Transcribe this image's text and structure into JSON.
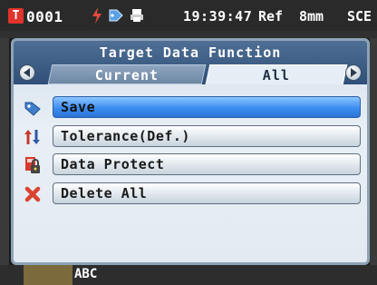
{
  "status_bar": {
    "target_badge": "T",
    "code": "0001",
    "time": "19:39:47",
    "ref": "Ref",
    "aperture": "8mm",
    "mode": "SCE",
    "icons": [
      "lightning-icon",
      "tag-icon",
      "printer-icon"
    ]
  },
  "dialog": {
    "title": "Target Data Function",
    "tabs": [
      {
        "label": "Current",
        "active": false
      },
      {
        "label": "All",
        "active": true
      }
    ],
    "items": [
      {
        "label": "Save",
        "icon": "save-tag-icon",
        "selected": true
      },
      {
        "label": "Tolerance(Def.)",
        "icon": "tolerance-icon",
        "selected": false
      },
      {
        "label": "Data Protect",
        "icon": "lock-icon",
        "selected": false
      },
      {
        "label": "Delete All",
        "icon": "delete-x-icon",
        "selected": false
      }
    ]
  },
  "bottom_bar": {
    "label": "ABC"
  },
  "colors": {
    "accent_selected": "#3c8df0",
    "badge_red": "#e1342c",
    "header_blue": "#2f4f78"
  }
}
